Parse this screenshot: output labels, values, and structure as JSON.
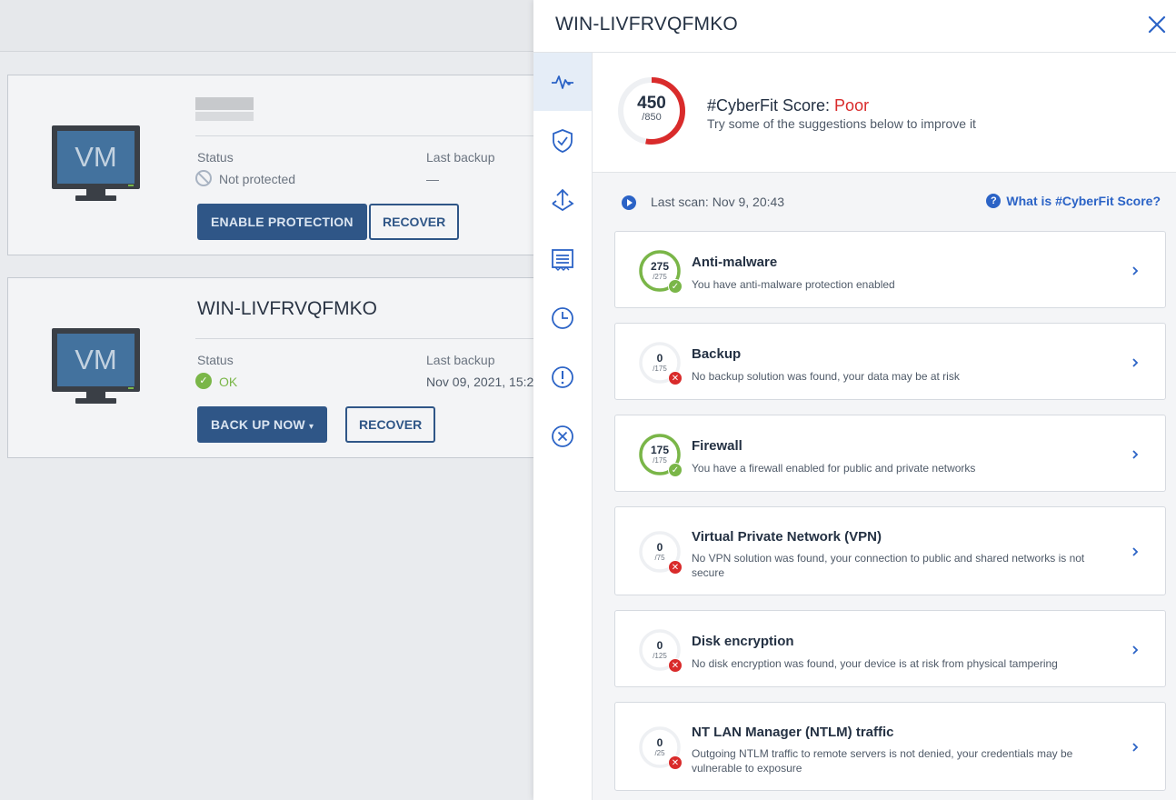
{
  "background": {
    "devices": [
      {
        "name": "",
        "status_label": "Status",
        "status_value": "Not protected",
        "last_backup_label": "Last backup",
        "last_backup_value": "—",
        "primary_button": "ENABLE PROTECTION",
        "secondary_button": "RECOVER",
        "vm_label": "VM"
      },
      {
        "name": "WIN-LIVFRVQFMKO",
        "status_label": "Status",
        "status_value": "OK",
        "last_backup_label": "Last backup",
        "last_backup_value": "Nov 09, 2021, 15:2",
        "primary_button": "BACK UP NOW",
        "secondary_button": "RECOVER",
        "vm_label": "VM"
      }
    ]
  },
  "panel": {
    "title": "WIN-LIVFRVQFMKO",
    "rail_icons": [
      "activity-icon",
      "shield-check-icon",
      "backup-upload-icon",
      "list-icon",
      "clock-icon",
      "alert-icon",
      "close-circle-icon"
    ],
    "score": {
      "value": "450",
      "max": "/850",
      "fraction": 0.529,
      "title_prefix": "#CyberFit Score: ",
      "rating": "Poor",
      "subtitle": "Try some of the suggestions below to improve it"
    },
    "last_scan": "Last scan: Nov 9, 20:43",
    "help_link": "What is #CyberFit Score?",
    "items": [
      {
        "title": "Anti-malware",
        "desc": "You have anti-malware protection enabled",
        "score": "275",
        "max": "/275",
        "fraction": 1,
        "ok": true
      },
      {
        "title": "Backup",
        "desc": "No backup solution was found, your data may be at risk",
        "score": "0",
        "max": "/175",
        "fraction": 0,
        "ok": false
      },
      {
        "title": "Firewall",
        "desc": "You have a firewall enabled for public and private networks",
        "score": "175",
        "max": "/175",
        "fraction": 1,
        "ok": true
      },
      {
        "title": "Virtual Private Network (VPN)",
        "desc": "No VPN solution was found, your connection to public and shared networks is not secure",
        "score": "0",
        "max": "/75",
        "fraction": 0,
        "ok": false
      },
      {
        "title": "Disk encryption",
        "desc": "No disk encryption was found, your device is at risk from physical tampering",
        "score": "0",
        "max": "/125",
        "fraction": 0,
        "ok": false
      },
      {
        "title": "NT LAN Manager (NTLM) traffic",
        "desc": "Outgoing NTLM traffic to remote servers is not denied, your credentials may be vulnerable to exposure",
        "score": "0",
        "max": "/25",
        "fraction": 0,
        "ok": false
      }
    ]
  },
  "colors": {
    "accent": "#2b63c6",
    "ok": "#7ab648",
    "bad": "#d92b2b",
    "primary_button": "#2f5687"
  }
}
